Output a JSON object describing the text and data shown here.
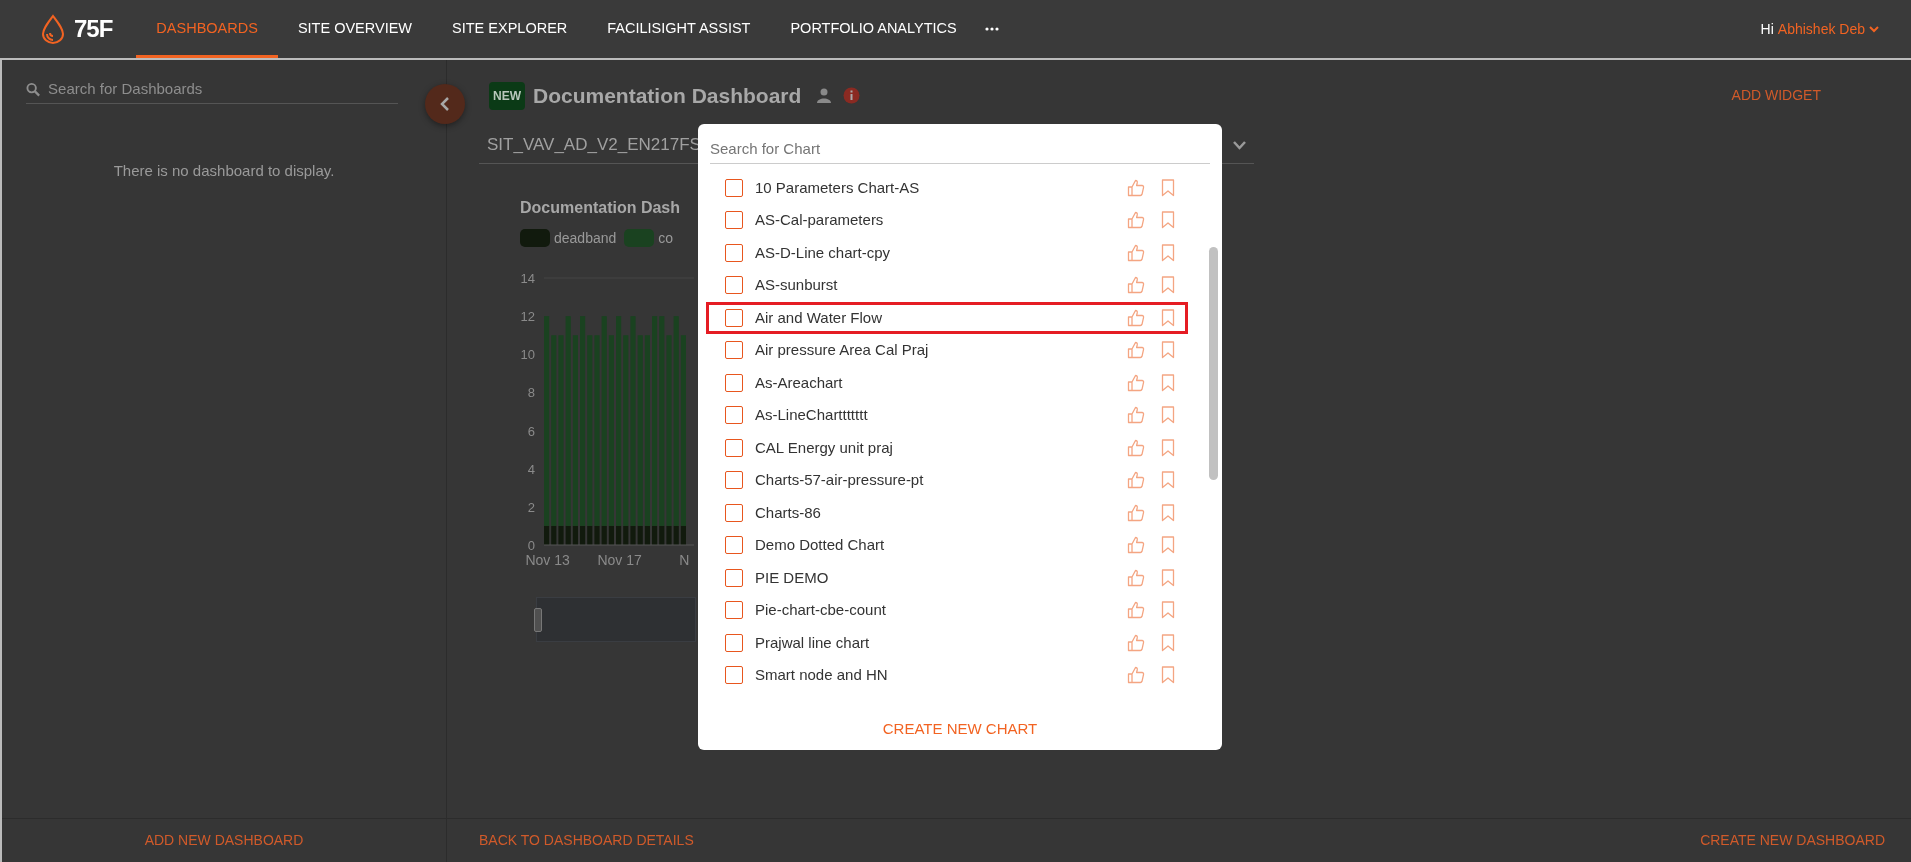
{
  "header": {
    "logo_text": "75F",
    "nav": [
      {
        "label": "DASHBOARDS",
        "selected": true
      },
      {
        "label": "SITE OVERVIEW",
        "selected": false
      },
      {
        "label": "SITE EXPLORER",
        "selected": false
      },
      {
        "label": "FACILISIGHT ASSIST",
        "selected": false
      },
      {
        "label": "PORTFOLIO ANALYTICS",
        "selected": false
      }
    ],
    "greeting": "Hi",
    "user": "Abhishek Deb"
  },
  "sidebar": {
    "search": {
      "placeholder": "Search for Dashboards"
    },
    "empty_message": "There is no dashboard to display.",
    "footer_action": "ADD NEW DASHBOARD"
  },
  "dashboard": {
    "badge": "NEW",
    "title": "Documentation Dashboard",
    "action": "ADD WIDGET",
    "site_select": "SIT_VAV_AD_V2_EN217FS",
    "widget": {
      "title": "Documentation Dash",
      "chart_data": {
        "type": "bar",
        "stacked": true,
        "orientation": "vertical",
        "categories": [
          "Nov 13",
          null,
          null,
          null,
          null,
          null,
          null,
          null,
          null,
          null,
          "Nov 17",
          null,
          null,
          null,
          null,
          null,
          null,
          null,
          null,
          "N"
        ],
        "series": [
          {
            "name": "deadband",
            "color": "#111a0d",
            "values": [
              1,
              1,
              1,
              1,
              1,
              1,
              1,
              1,
              1,
              1,
              1,
              1,
              1,
              1,
              1,
              1,
              1,
              1,
              1,
              1
            ]
          },
          {
            "name": "co",
            "color": "#1a4220",
            "values": [
              11,
              10,
              10,
              11,
              10,
              11,
              10,
              10,
              11,
              10,
              11,
              10,
              11,
              10,
              10,
              11,
              11,
              10,
              11,
              10
            ]
          }
        ],
        "ylim": [
          0,
          14
        ],
        "yticks": [
          0,
          2,
          4,
          6,
          8,
          10,
          12,
          14
        ]
      }
    },
    "footer_actions": [
      "BACK TO DASHBOARD DETAILS",
      "CREATE NEW DASHBOARD"
    ]
  },
  "modal": {
    "search": {
      "placeholder": "Search for Chart"
    },
    "charts": [
      {
        "name": "10 Parameters Chart-AS",
        "checked": false,
        "highlighted": false
      },
      {
        "name": "AS-Cal-parameters",
        "checked": false,
        "highlighted": false
      },
      {
        "name": "AS-D-Line chart-cpy",
        "checked": false,
        "highlighted": false
      },
      {
        "name": "AS-sunburst",
        "checked": false,
        "highlighted": false
      },
      {
        "name": "Air and Water Flow",
        "checked": false,
        "highlighted": true
      },
      {
        "name": "Air pressure Area Cal Praj",
        "checked": false,
        "highlighted": false
      },
      {
        "name": "As-Areachart",
        "checked": false,
        "highlighted": false
      },
      {
        "name": "As-LineCharttttttt",
        "checked": false,
        "highlighted": false
      },
      {
        "name": "CAL Energy unit praj",
        "checked": false,
        "highlighted": false
      },
      {
        "name": "Charts-57-air-pressure-pt",
        "checked": false,
        "highlighted": false
      },
      {
        "name": "Charts-86",
        "checked": false,
        "highlighted": false
      },
      {
        "name": "Demo Dotted Chart",
        "checked": false,
        "highlighted": false
      },
      {
        "name": "PIE DEMO",
        "checked": false,
        "highlighted": false
      },
      {
        "name": "Pie-chart-cbe-count",
        "checked": false,
        "highlighted": false
      },
      {
        "name": "Prajwal line chart",
        "checked": false,
        "highlighted": false
      },
      {
        "name": "Smart node and HN",
        "checked": false,
        "highlighted": false
      }
    ],
    "action": "CREATE NEW CHART"
  }
}
